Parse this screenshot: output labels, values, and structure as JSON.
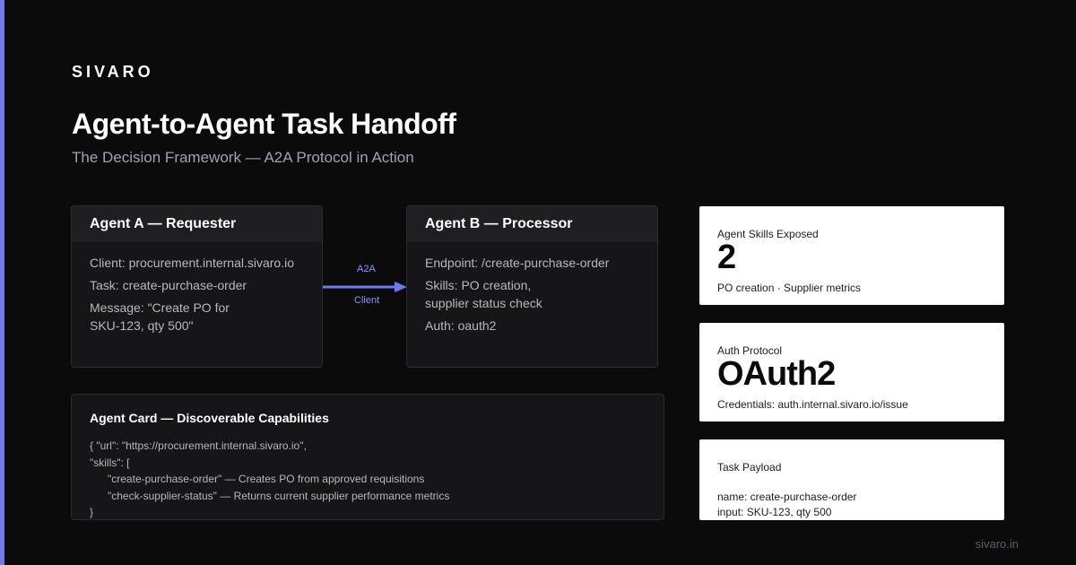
{
  "brand": "SIVARO",
  "title": "Agent-to-Agent Task Handoff",
  "subtitle": "The Decision Framework — A2A Protocol in Action",
  "accent_color": "#7078ee",
  "agent_a": {
    "heading": "Agent A — Requester",
    "lines": [
      "Client: procurement.internal.sivaro.io",
      "Task: create-purchase-order",
      "Message: \"Create PO for\nSKU-123, qty 500\""
    ]
  },
  "agent_b": {
    "heading": "Agent B — Processor",
    "lines": [
      "Endpoint: /create-purchase-order",
      "Skills: PO creation,\nsupplier status check",
      "Auth: oauth2"
    ]
  },
  "link": {
    "top_label": "A2A",
    "bottom_label": "Client",
    "arrow_icon": "arrow-right-icon"
  },
  "agent_card": {
    "heading": "Agent Card — Discoverable Capabilities",
    "lines": [
      "{ \"url\": \"https://procurement.internal.sivaro.io\",",
      "\"skills\": [",
      "\"create-purchase-order\" — Creates PO from approved requisitions",
      "\"check-supplier-status\" — Returns current supplier performance metrics",
      "}"
    ]
  },
  "stats": {
    "skills": {
      "label": "Agent Skills Exposed",
      "value": "2",
      "note": "PO creation · Supplier metrics"
    },
    "auth": {
      "label": "Auth Protocol",
      "value": "OAuth2",
      "note": "Credentials: auth.internal.sivaro.io/issue"
    },
    "payload": {
      "label": "Task Payload",
      "lines": [
        "name: create-purchase-order",
        "input: SKU-123, qty 500"
      ]
    }
  },
  "footer": "sivaro.in"
}
